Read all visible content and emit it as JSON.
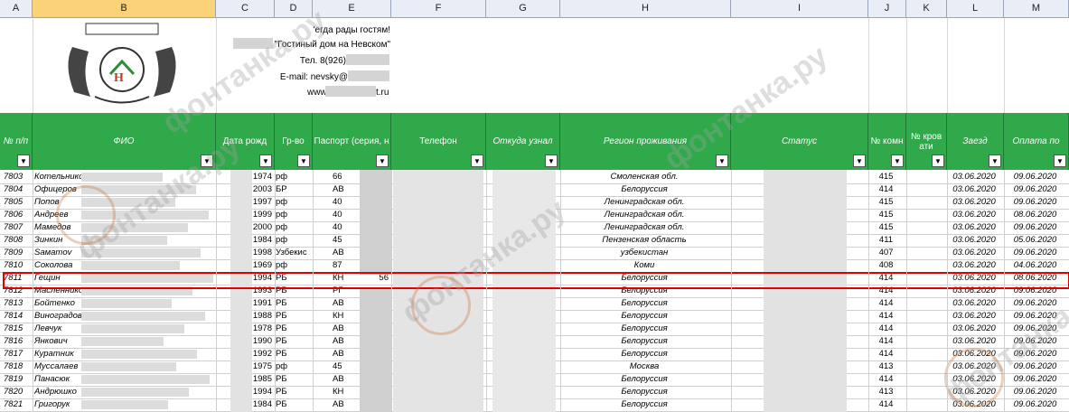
{
  "columns": [
    "A",
    "B",
    "C",
    "D",
    "E",
    "F",
    "G",
    "H",
    "I",
    "J",
    "K",
    "L",
    "M"
  ],
  "selected_column": "B",
  "hotel_info": {
    "line1": "'егда рады гостям!",
    "line2": "\"Гостиный дом на Невском\"",
    "line3": "Тел. 8(926)",
    "line4": "E-mail: nevsky@",
    "line5": "www.h",
    "line5_end": "t.ru"
  },
  "headers": [
    "№ п/п",
    "ФИО",
    "Дата рожд",
    "Гр-во",
    "Паспорт (серия, н",
    "Телефон",
    "Откуда узнал",
    "Регион проживания",
    "Статус",
    "№ комн",
    "№ кров ати",
    "Заезд",
    "Оплата по"
  ],
  "watermark": "фонтанка.ру",
  "rows": [
    {
      "n": "7803",
      "fio": "Котельников",
      "dob": ".1974",
      "cit": "рф",
      "pass": "66",
      "region": "Смоленская обл.",
      "room": "415",
      "in": "03.06.2020",
      "out": "09.06.2020"
    },
    {
      "n": "7804",
      "fio": "Офицеров",
      "dob": "2003",
      "cit": "БР",
      "pass": "АВ",
      "region": "Белоруссия",
      "room": "414",
      "in": "03.06.2020",
      "out": "09.06.2020"
    },
    {
      "n": "7805",
      "fio": "Попов",
      "dob": "1997",
      "cit": "рф",
      "pass": "40",
      "region": "Ленинградская обл.",
      "room": "415",
      "in": "03.06.2020",
      "out": "09.06.2020"
    },
    {
      "n": "7806",
      "fio": "Андреев",
      "dob": "1999",
      "cit": "рф",
      "pass": "40",
      "region": "Ленинградская обл.",
      "room": "415",
      "in": "03.06.2020",
      "out": "08.06.2020"
    },
    {
      "n": "7807",
      "fio": "Мамедов",
      "dob": "2000",
      "cit": "рф",
      "pass": "40",
      "region": "Ленинградская обл.",
      "room": "415",
      "in": "03.06.2020",
      "out": "09.06.2020"
    },
    {
      "n": "7808",
      "fio": "Зинкин",
      "dob": "1984",
      "cit": "рф",
      "pass": "45",
      "region": "Пензенская область",
      "room": "411",
      "in": "03.06.2020",
      "out": "05.06.2020"
    },
    {
      "n": "7809",
      "fio": "Saматov",
      "dob": ".1998",
      "cit": "Узбекис",
      "pass": "АВ",
      "region": "узбекистан",
      "room": "407",
      "in": "03.06.2020",
      "out": "09.06.2020"
    },
    {
      "n": "7810",
      "fio": "Соколова",
      "dob": "1969",
      "cit": "рф",
      "pass": "87",
      "region": "Коми",
      "room": "408",
      "in": "03.06.2020",
      "out": "04.06.2020"
    },
    {
      "n": "7811",
      "fio": "Гещин",
      "dob": "1994",
      "cit": "РБ",
      "pass": "КН",
      "pass_end": "56",
      "region": "Белоруссия",
      "room": "414",
      "in": "03.06.2020",
      "out": "08.06.2020"
    },
    {
      "n": "7812",
      "fio": "Масленников",
      "dob": "1993",
      "cit": "РБ",
      "pass": "РГ",
      "region": "Белоруссия",
      "room": "414",
      "in": "03.06.2020",
      "out": "09.06.2020"
    },
    {
      "n": "7813",
      "fio": "Бойтенко",
      "dob": "1991",
      "cit": "РБ",
      "pass": "АВ",
      "region": "Белоруссия",
      "room": "414",
      "in": "03.06.2020",
      "out": "09.06.2020"
    },
    {
      "n": "7814",
      "fio": "Виноградов",
      "dob": "1988",
      "cit": "РБ",
      "pass": "КН",
      "region": "Белоруссия",
      "room": "414",
      "in": "03.06.2020",
      "out": "09.06.2020"
    },
    {
      "n": "7815",
      "fio": "Левчук",
      "dob": "1978",
      "cit": "РБ",
      "pass": "АВ",
      "region": "Белоруссия",
      "room": "414",
      "in": "03.06.2020",
      "out": "09.06.2020"
    },
    {
      "n": "7816",
      "fio": "Янкович",
      "dob": "1990",
      "cit": "РБ",
      "pass": "АВ",
      "region": "Белоруссия",
      "room": "414",
      "in": "03.06.2020",
      "out": "09.06.2020"
    },
    {
      "n": "7817",
      "fio": "Куратник",
      "dob": "1992",
      "cit": "РБ",
      "pass": "АВ",
      "region": "Белоруссия",
      "room": "414",
      "in": "03.06.2020",
      "out": "09.06.2020"
    },
    {
      "n": "7818",
      "fio": "Муссалаев",
      "dob": "1975",
      "cit": "рф",
      "pass": "45",
      "region": "Москва",
      "room": "413",
      "in": "03.06.2020",
      "out": "09.06.2020"
    },
    {
      "n": "7819",
      "fio": "Панасюк",
      "dob": "1985",
      "cit": "РБ",
      "pass": "АВ",
      "region": "Белоруссия",
      "room": "414",
      "in": "03.06.2020",
      "out": "09.06.2020"
    },
    {
      "n": "7820",
      "fio": "Андрюшко",
      "dob": "1994",
      "cit": "РБ",
      "pass": "КН",
      "region": "Белоруссия",
      "room": "413",
      "in": "03.06.2020",
      "out": "09.06.2020"
    },
    {
      "n": "7821",
      "fio": "Григорук",
      "dob": "1984",
      "cit": "РБ",
      "pass": "АВ",
      "region": "Белоруссия",
      "room": "414",
      "in": "03.06.2020",
      "out": "09.06.2020"
    }
  ]
}
